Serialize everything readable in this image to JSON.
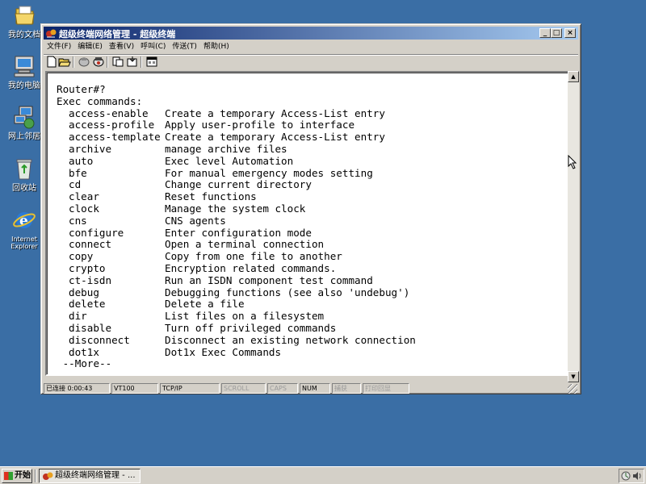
{
  "desktop": {
    "icons": [
      {
        "label": "我的文档",
        "icon": "my-documents-icon"
      },
      {
        "label": "我的电脑",
        "icon": "my-computer-icon"
      },
      {
        "label": "网上邻居",
        "icon": "network-neighborhood-icon"
      },
      {
        "label": "回收站",
        "icon": "recycle-bin-icon"
      },
      {
        "label": "Internet Explorer",
        "icon": "internet-explorer-icon"
      }
    ]
  },
  "window": {
    "title": "超级终端网络管理 - 超级终端",
    "controls": {
      "minimize": "_",
      "maximize": "□",
      "close": "×"
    },
    "menu": [
      "文件(F)",
      "编辑(E)",
      "查看(V)",
      "呼叫(C)",
      "传送(T)",
      "帮助(H)"
    ],
    "toolbar": [
      "new-document-icon",
      "open-folder-icon",
      "disconnect-icon",
      "dial-icon",
      "send-icon",
      "receive-icon",
      "properties-icon"
    ]
  },
  "terminal": {
    "prompt": "Router#?",
    "header": "Exec commands:",
    "commands": [
      {
        "cmd": "access-enable",
        "desc": "Create a temporary Access-List entry"
      },
      {
        "cmd": "access-profile",
        "desc": "Apply user-profile to interface"
      },
      {
        "cmd": "access-template",
        "desc": "Create a temporary Access-List entry"
      },
      {
        "cmd": "archive",
        "desc": "manage archive files"
      },
      {
        "cmd": "auto",
        "desc": "Exec level Automation"
      },
      {
        "cmd": "bfe",
        "desc": "For manual emergency modes setting"
      },
      {
        "cmd": "cd",
        "desc": "Change current directory"
      },
      {
        "cmd": "clear",
        "desc": "Reset functions"
      },
      {
        "cmd": "clock",
        "desc": "Manage the system clock"
      },
      {
        "cmd": "cns",
        "desc": "CNS agents"
      },
      {
        "cmd": "configure",
        "desc": "Enter configuration mode"
      },
      {
        "cmd": "connect",
        "desc": "Open a terminal connection"
      },
      {
        "cmd": "copy",
        "desc": "Copy from one file to another"
      },
      {
        "cmd": "crypto",
        "desc": "Encryption related commands."
      },
      {
        "cmd": "ct-isdn",
        "desc": "Run an ISDN component test command"
      },
      {
        "cmd": "debug",
        "desc": "Debugging functions (see also 'undebug')"
      },
      {
        "cmd": "delete",
        "desc": "Delete a file"
      },
      {
        "cmd": "dir",
        "desc": "List files on a filesystem"
      },
      {
        "cmd": "disable",
        "desc": "Turn off privileged commands"
      },
      {
        "cmd": "disconnect",
        "desc": "Disconnect an existing network connection"
      },
      {
        "cmd": "dot1x",
        "desc": "Dot1x Exec Commands"
      }
    ],
    "more": " --More--"
  },
  "statusbar": {
    "connected": "已连接 0:00:43",
    "emulation": "VT100",
    "protocol": "TCP/IP",
    "scroll": "SCROLL",
    "caps": "CAPS",
    "num": "NUM",
    "capture": "捕获",
    "print_echo": "打印回显"
  },
  "taskbar": {
    "start": "开始",
    "task": "超级终端网络管理 - ..."
  }
}
